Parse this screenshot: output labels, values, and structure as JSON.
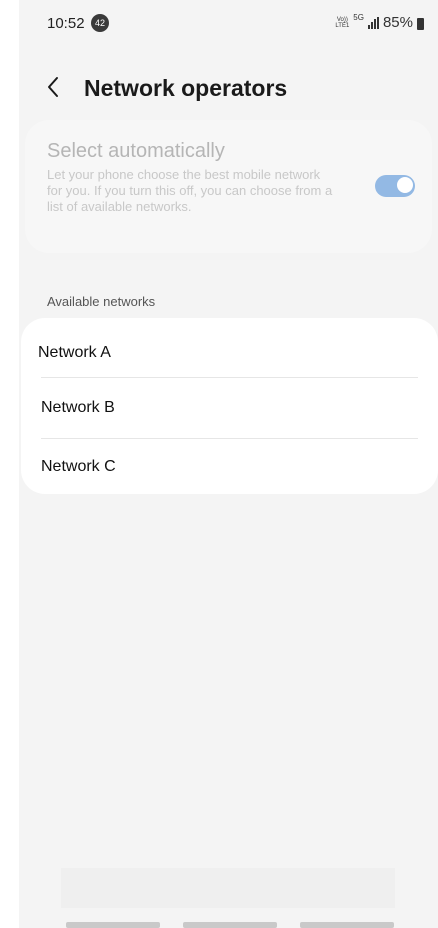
{
  "status_bar": {
    "time": "10:52",
    "notification_count": "42",
    "volte_label": "Vo))",
    "lte_label": "LTE1",
    "network_type": "5G",
    "battery": "85%"
  },
  "header": {
    "back_icon": "chevron-left-icon",
    "title": "Network operators"
  },
  "auto_select": {
    "title": "Select automatically",
    "description": "Let your phone choose the best mobile network for you. If you turn this off, you can choose from a list of available networks.",
    "enabled": true
  },
  "available": {
    "section_label": "Available networks",
    "networks": [
      {
        "label": "Network A"
      },
      {
        "label": "Network B"
      },
      {
        "label": "Network C"
      }
    ]
  },
  "colors": {
    "background": "#f4f4f4",
    "card": "#ffffff",
    "toggle_accent": "#93b9e4",
    "disabled_text": "#b5b5b5"
  }
}
